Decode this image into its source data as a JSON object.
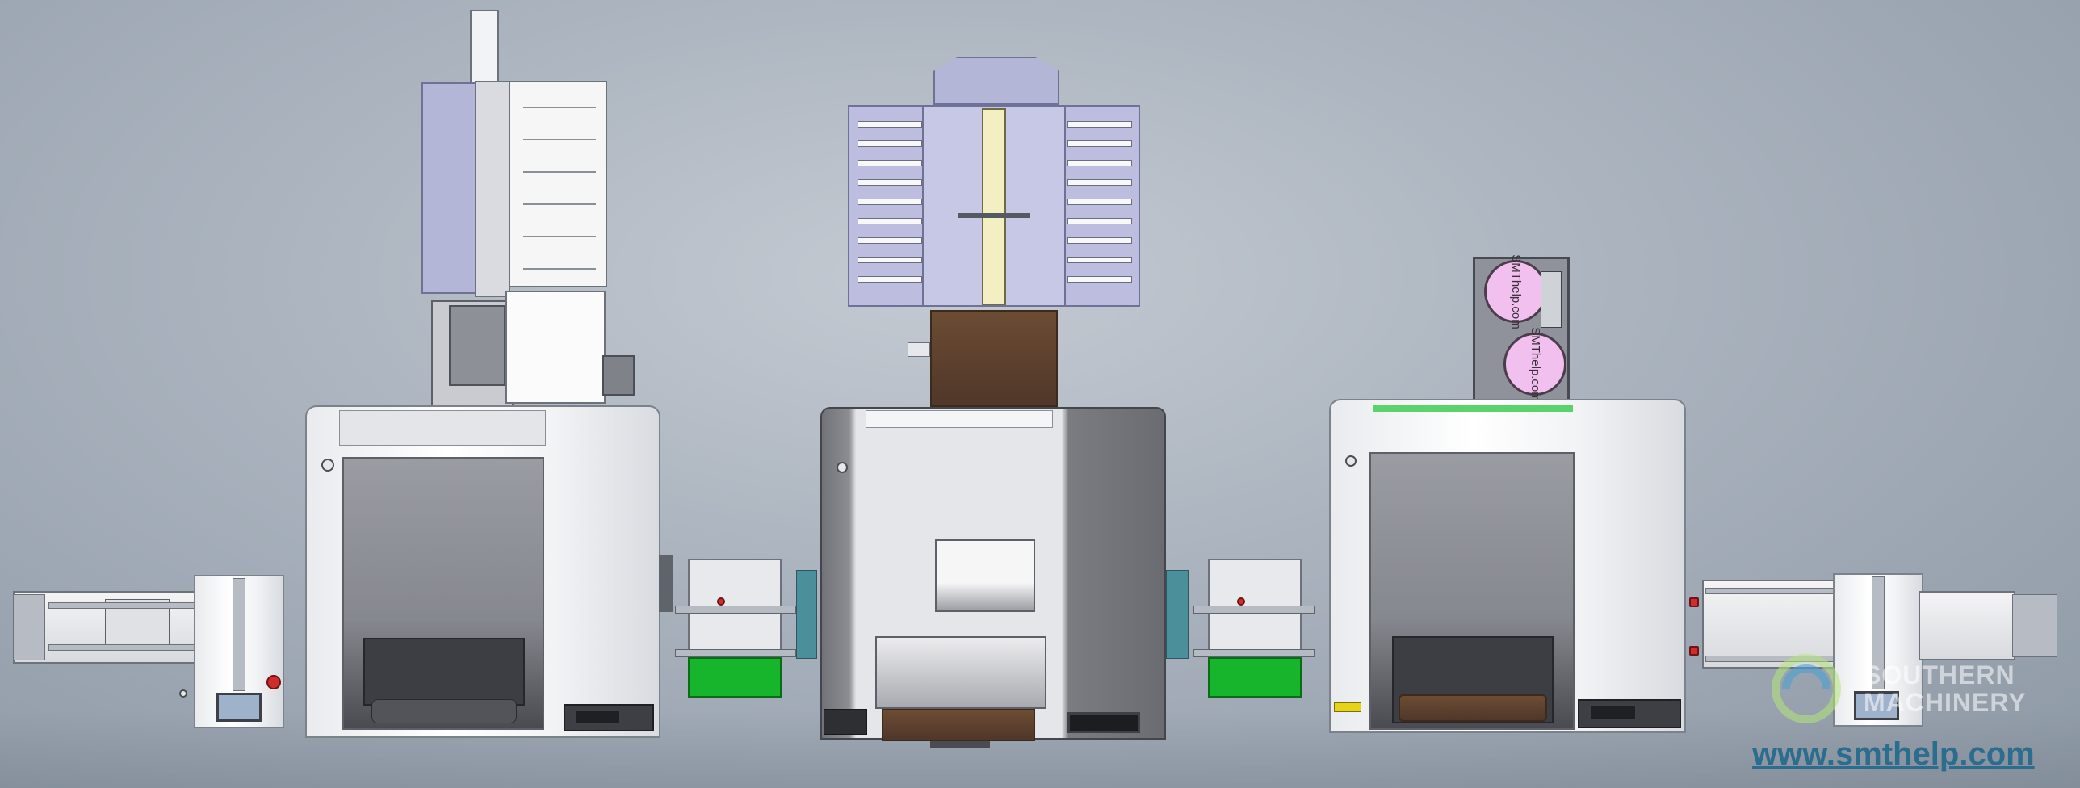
{
  "watermark": {
    "line1": "SOUTHERN",
    "line2": "MACHINERY",
    "url": "www.smthelp.com",
    "logo_icon": "sm-logo-icon"
  },
  "reel_labels": [
    "SMThelp.com",
    "SMThelp.com"
  ],
  "colors": {
    "background": "#a9b2bd",
    "green_bin": "#17b52c",
    "lavender_head": "#b4b6d8",
    "brown_panel": "#5a3f2d",
    "url_blue": "#2c6d8e",
    "reel_pink": "#f2c0ee"
  }
}
